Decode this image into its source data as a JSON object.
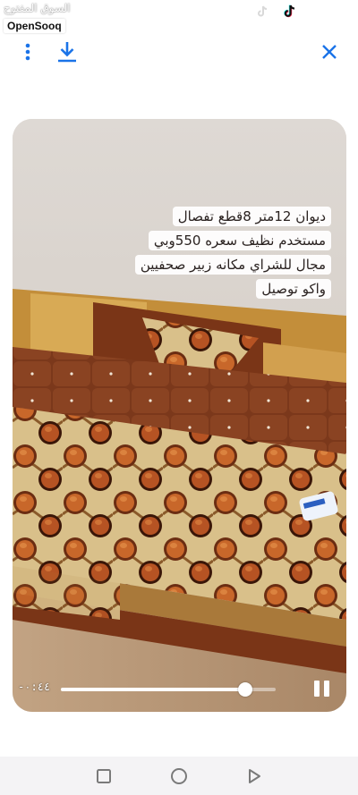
{
  "watermark": {
    "arabic": "السوق المفتوح",
    "latin": "OpenSooq"
  },
  "icons": {
    "more": "vertical-dots-icon",
    "download": "download-icon",
    "close": "close-x-icon",
    "tiktok": "tiktok-icon",
    "pause": "pause-icon",
    "nav_recents": "square-recents-icon",
    "nav_home": "circle-home-icon",
    "nav_back": "triangle-back-icon"
  },
  "colors": {
    "accent": "#1a73e8",
    "sofa_brown": "#7a3a1c",
    "orange": "#d8702e"
  },
  "caption": {
    "lines": [
      "ديوان 12متر 8قطع تفصال",
      "مستخدم نظيف سعره 550وبي",
      "مجال للشراي مكانه زبير صحفيين",
      "واكو توصيل"
    ]
  },
  "player": {
    "time": "-٠:٤٤",
    "progress": 0.86
  }
}
